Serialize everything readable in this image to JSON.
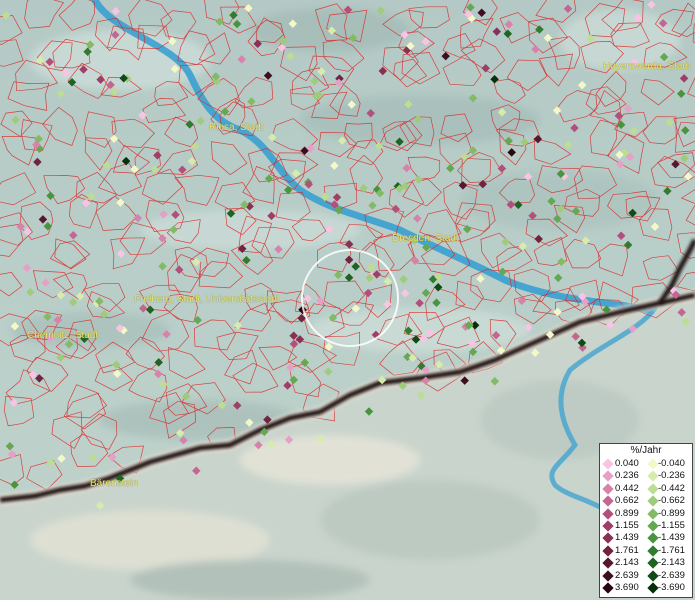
{
  "map": {
    "cities": [
      {
        "name": "Hoyerswerda, Stadt",
        "key": "hoyerswerda"
      },
      {
        "name": "Riesa, Stadt",
        "key": "riesa"
      },
      {
        "name": "Dresden, Stadt",
        "key": "dresden"
      },
      {
        "name": "Freiberg, Stadt, Universitätsstadt",
        "key": "freiberg"
      },
      {
        "name": "Chemnitz, Stadt",
        "key": "chemnitz"
      },
      {
        "name": "Bärenstein",
        "key": "baerenstein"
      }
    ],
    "colors": {
      "river": "#3aa0d0",
      "boundaries": "#d82828",
      "border": "#1a1010",
      "selection_circle": "#ffffff"
    }
  },
  "legend": {
    "title": "%/Jahr",
    "rows": [
      {
        "pos": "0.040",
        "pos_color": "#f7c4e4",
        "neg": "-0.040",
        "neg_color": "#f3f8c8"
      },
      {
        "pos": "0.236",
        "pos_color": "#e6a0c8",
        "neg": "-0.236",
        "neg_color": "#d7ecac"
      },
      {
        "pos": "0.442",
        "pos_color": "#d683ac",
        "neg": "-0.442",
        "neg_color": "#bcdd94"
      },
      {
        "pos": "0.662",
        "pos_color": "#c46694",
        "neg": "-0.662",
        "neg_color": "#9fcc7c"
      },
      {
        "pos": "0.899",
        "pos_color": "#b24f7c",
        "neg": "-0.899",
        "neg_color": "#83ba66"
      },
      {
        "pos": "1.155",
        "pos_color": "#9e3f68",
        "neg": "-1.155",
        "neg_color": "#65a852"
      },
      {
        "pos": "1.439",
        "pos_color": "#883154",
        "neg": "-1.439",
        "neg_color": "#4a9440"
      },
      {
        "pos": "1.761",
        "pos_color": "#6f2440",
        "neg": "-1.761",
        "neg_color": "#317c30"
      },
      {
        "pos": "2.143",
        "pos_color": "#561830",
        "neg": "-2.143",
        "neg_color": "#1f6422"
      },
      {
        "pos": "2.639",
        "pos_color": "#3e0e20",
        "neg": "-2.639",
        "neg_color": "#104a14"
      },
      {
        "pos": "3.690",
        "pos_color": "#280612",
        "neg": "-3.690",
        "neg_color": "#06300a"
      }
    ]
  }
}
